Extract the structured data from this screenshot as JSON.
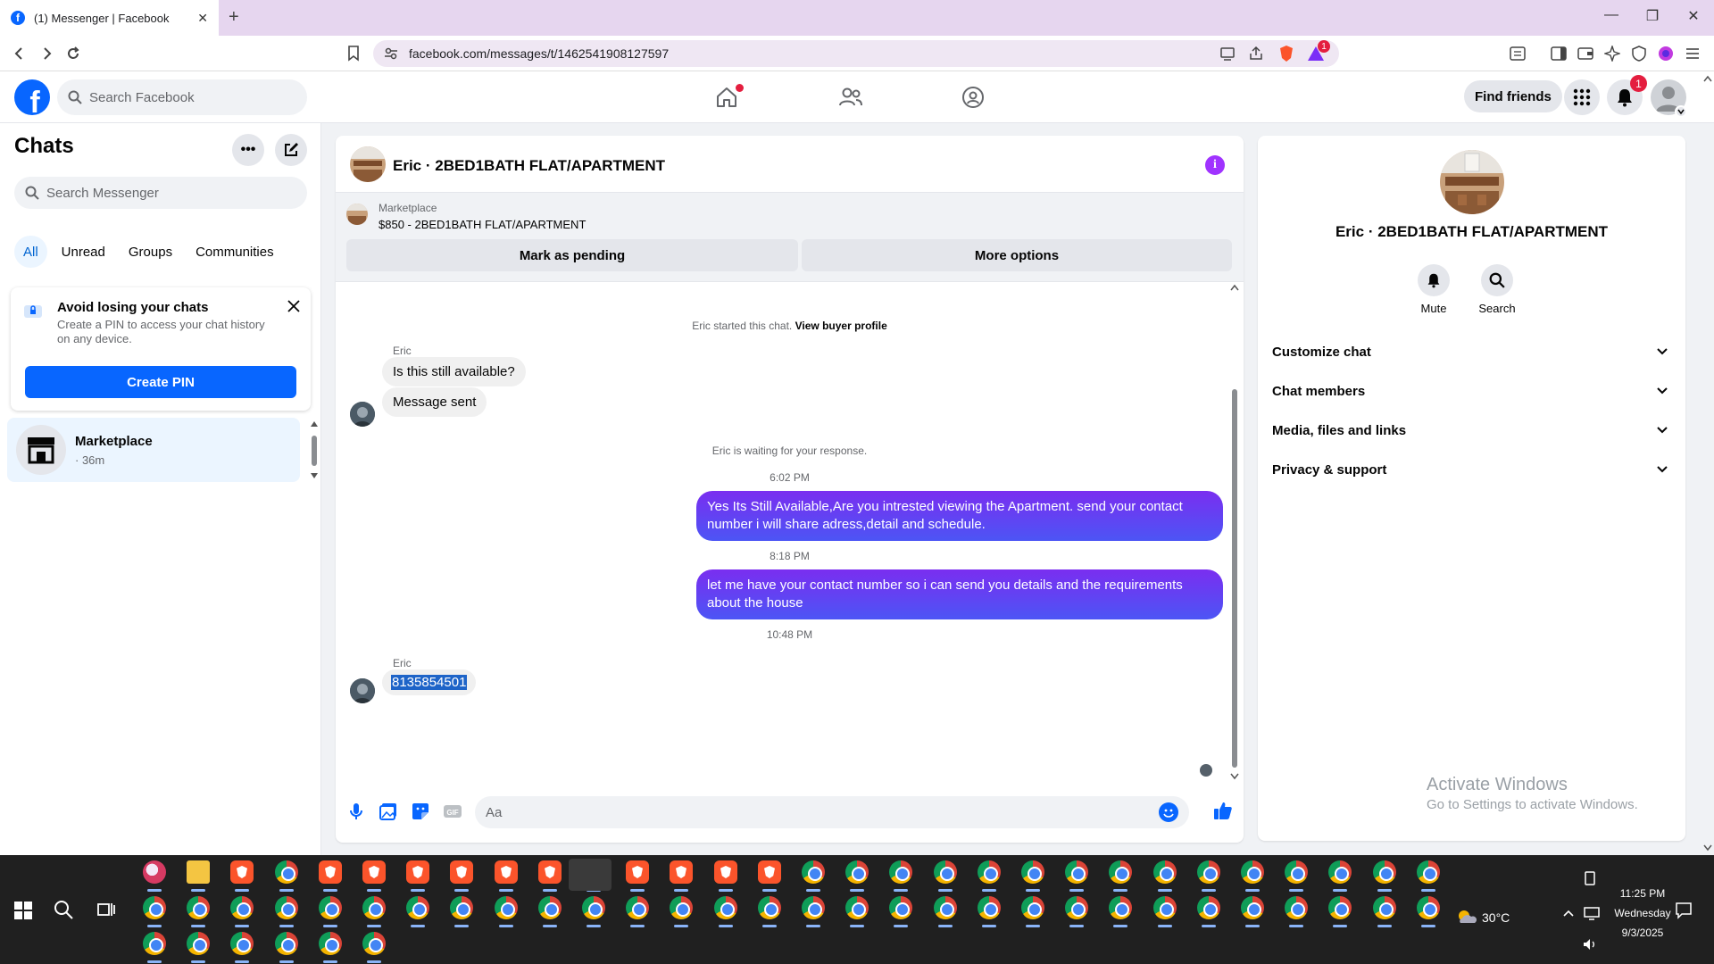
{
  "browser": {
    "tab_title": "(1) Messenger | Facebook",
    "url": "facebook.com/messages/t/1462541908127597",
    "brave_badge": "1"
  },
  "fb_header": {
    "search_placeholder": "Search Facebook",
    "find_friends": "Find friends",
    "notification_count": "1"
  },
  "sidebar": {
    "title": "Chats",
    "search_placeholder": "Search Messenger",
    "filters": [
      "All",
      "Unread",
      "Groups",
      "Communities"
    ],
    "pin_card": {
      "title": "Avoid losing your chats",
      "description": "Create a PIN to access your chat history on any device.",
      "button": "Create PIN"
    },
    "conversations": [
      {
        "name": "Marketplace",
        "time": "· 36m"
      }
    ]
  },
  "conversation": {
    "title": "Eric · 2BED1BATH FLAT/APARTMENT",
    "marketplace_label": "Marketplace",
    "listing": "$850 - 2BED1BATH FLAT/APARTMENT",
    "mark_pending": "Mark as pending",
    "more_options": "More options",
    "started_text": "Eric started this chat.",
    "view_buyer_profile": "View buyer profile",
    "sender_name": "Eric",
    "msg_1": "Is this still available?",
    "msg_2": "Message sent",
    "waiting_text": "Eric is waiting for your response.",
    "time_1": "6:02 PM",
    "out_1": "Yes Its Still Available,Are you intrested viewing the Apartment. send your contact number i will share adress,detail and schedule.",
    "time_2": "8:18 PM",
    "out_2": "let me have your contact number so i can send you details and the requirements about the house",
    "time_3": "10:48 PM",
    "sender_name_2": "Eric",
    "msg_3": "8135854501",
    "composer_placeholder": "Aa"
  },
  "right_panel": {
    "name": "Eric · 2BED1BATH FLAT/APARTMENT",
    "mute": "Mute",
    "search": "Search",
    "sections": [
      "Customize chat",
      "Chat members",
      "Media, files and links",
      "Privacy & support"
    ]
  },
  "watermark": {
    "line1": "Activate Windows",
    "line2": "Go to Settings to activate Windows."
  },
  "taskbar": {
    "weather": "30°C",
    "time": "11:25 PM",
    "day": "Wednesday",
    "date": "9/3/2025"
  },
  "colors": {
    "fb_blue": "#0866ff",
    "outgoing_bubble": "#5b35e6",
    "info_purple": "#a033ff",
    "badge_red": "#e41e3f"
  }
}
